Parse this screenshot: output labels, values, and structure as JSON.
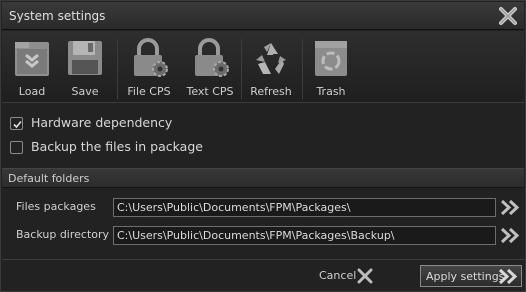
{
  "window": {
    "title": "System settings"
  },
  "toolbar": {
    "items": [
      {
        "label": "Load",
        "icon": "folder-load-icon"
      },
      {
        "label": "Save",
        "icon": "floppy-save-icon"
      },
      {
        "label": "File CPS",
        "icon": "lock-gear-icon"
      },
      {
        "label": "Text CPS",
        "icon": "lock-gear-icon"
      },
      {
        "label": "Refresh",
        "icon": "recycle-icon"
      },
      {
        "label": "Trash",
        "icon": "trash-icon"
      }
    ]
  },
  "options": {
    "hardware_dependency": {
      "label": "Hardware dependency",
      "checked": true
    },
    "backup_files": {
      "label": "Backup the files in package",
      "checked": false
    }
  },
  "default_folders": {
    "header": "Default folders",
    "files_packages": {
      "label": "Files packages",
      "value": "C:\\Users\\Public\\Documents\\FPM\\Packages\\"
    },
    "backup_directory": {
      "label": "Backup directory",
      "value": "C:\\Users\\Public\\Documents\\FPM\\Packages\\Backup\\"
    }
  },
  "footer": {
    "cancel_label": "Cancel",
    "apply_label": "Apply settings"
  }
}
